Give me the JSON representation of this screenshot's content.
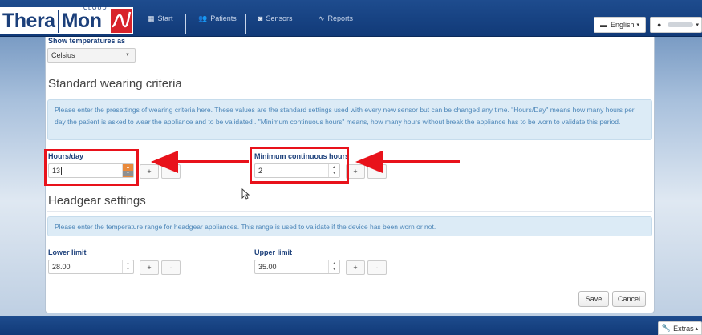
{
  "logo": {
    "part1": "Thera",
    "part2": "Mon",
    "cloud": "CLOUD"
  },
  "nav": [
    {
      "label": "Start",
      "icon": "grid-icon"
    },
    {
      "label": "Patients",
      "icon": "users-icon"
    },
    {
      "label": "Sensors",
      "icon": "sensor-icon"
    },
    {
      "label": "Reports",
      "icon": "chart-icon"
    }
  ],
  "language": {
    "label": "English",
    "caret": "▾",
    "icon": "comment-icon"
  },
  "user": {
    "icon": "user-icon",
    "caret": "▾"
  },
  "temperature": {
    "label": "Show temperatures as",
    "value": "Celsius"
  },
  "wearing": {
    "title": "Standard wearing criteria",
    "info": "Please enter the presettings of wearing criteria here. These values are the standard settings used with every new sensor but can be changed any time. \"Hours/Day\" means how many hours per day the patient is asked to wear the appliance and to be validated . \"Minimum continuous hours\" means, how many hours without break the appliance has to be worn to validate this period.",
    "hours_label": "Hours/day",
    "hours_value": "13",
    "min_label": "Minimum continuous hours",
    "min_value": "2"
  },
  "headgear": {
    "title": "Headgear settings",
    "info": "Please enter the temperature range for headgear appliances. This range is used to validate if the device has been worn or not.",
    "lower_label": "Lower limit",
    "lower_value": "28.00",
    "upper_label": "Upper limit",
    "upper_value": "35.00"
  },
  "stepper": {
    "plus": "+",
    "minus": "-",
    "up": "▲",
    "down": "▼"
  },
  "actions": {
    "save": "Save",
    "cancel": "Cancel"
  },
  "footer": {
    "extras": "Extras",
    "caret": "▴"
  },
  "colors": {
    "accent": "#1b3f7a",
    "highlight": "#e8121b",
    "info_bg": "#dcebf6"
  }
}
